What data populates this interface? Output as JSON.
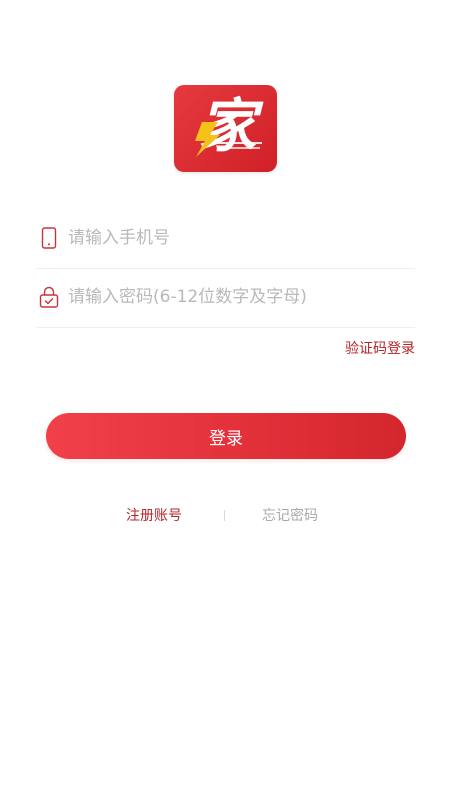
{
  "logo": {
    "char": "家",
    "icon": "home-lightning-logo",
    "bg_color": "#dc2a30",
    "bolt_color": "#f4c21b"
  },
  "form": {
    "phone": {
      "placeholder": "请输入手机号",
      "value": "",
      "icon": "phone-icon"
    },
    "password": {
      "placeholder": "请输入密码(6-12位数字及字母)",
      "value": "",
      "icon": "lock-icon"
    },
    "code_login_label": "验证码登录",
    "login_label": "登录"
  },
  "links": {
    "register_label": "注册账号",
    "forgot_label": "忘记密码"
  },
  "colors": {
    "accent": "#b4262c",
    "button": "#e3313a",
    "muted": "#a9a9a9"
  }
}
